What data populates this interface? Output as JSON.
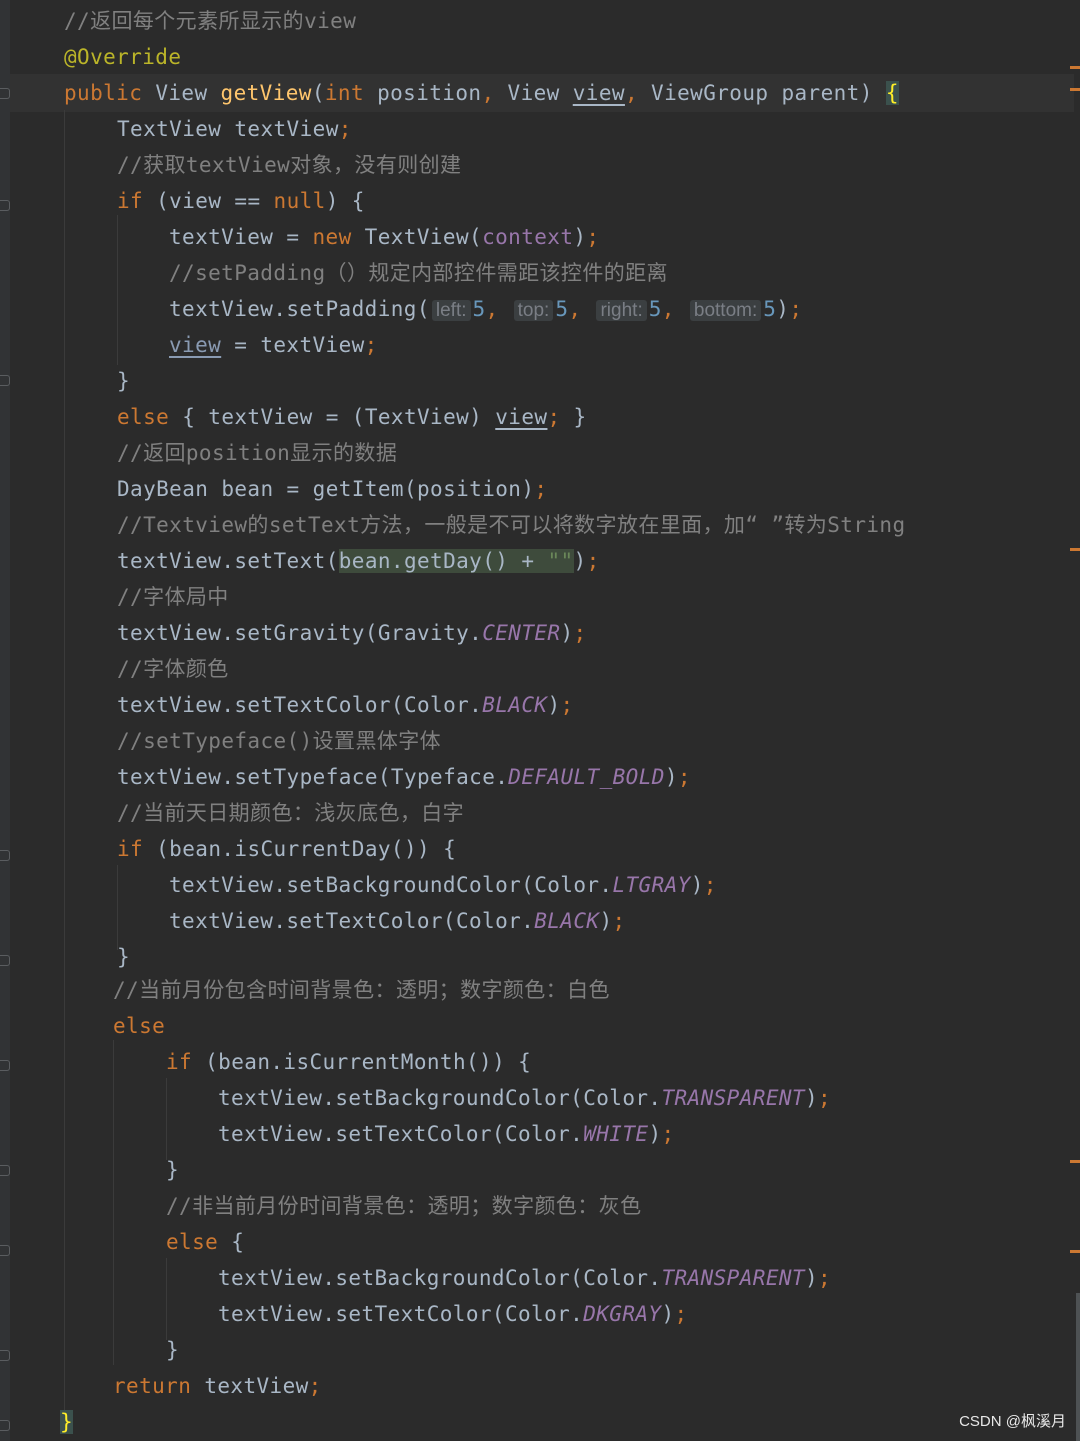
{
  "editor": {
    "lines": [
      [
        {
          "t": "//返回每个元素所显示的view",
          "c": "comment"
        }
      ],
      [
        {
          "t": "@Override",
          "c": "annotation"
        }
      ],
      [
        {
          "t": "public ",
          "c": "keyword"
        },
        {
          "t": "View "
        },
        {
          "t": "getView",
          "c": "method"
        },
        {
          "t": "("
        },
        {
          "t": "int ",
          "c": "keyword"
        },
        {
          "t": "position"
        },
        {
          "t": ", ",
          "c": "punct"
        },
        {
          "t": "View "
        },
        {
          "t": "view",
          "c": "var-under"
        },
        {
          "t": ", ",
          "c": "punct"
        },
        {
          "t": "ViewGroup parent) "
        },
        {
          "t": "{",
          "c": "brace-match"
        }
      ],
      [
        {
          "t": "TextView textView"
        },
        {
          "t": ";",
          "c": "punct"
        }
      ],
      [
        {
          "t": "//获取textView对象，没有则创建",
          "c": "comment"
        }
      ],
      [
        {
          "t": "if ",
          "c": "keyword"
        },
        {
          "t": "(view == "
        },
        {
          "t": "null",
          "c": "keyword"
        },
        {
          "t": ") {"
        }
      ],
      [
        {
          "t": "textView = "
        },
        {
          "t": "new ",
          "c": "keyword"
        },
        {
          "t": "TextView("
        },
        {
          "t": "context",
          "c": "field"
        },
        {
          "t": ")"
        },
        {
          "t": ";",
          "c": "punct"
        }
      ],
      [
        {
          "t": "//setPadding（）规定内部控件需距该控件的距离",
          "c": "comment"
        }
      ],
      [
        {
          "t": "textView.setPadding("
        },
        {
          "t": "left:",
          "c": "hint"
        },
        {
          "t": "5",
          "c": "number"
        },
        {
          "t": ", ",
          "c": "punct"
        },
        {
          "t": "top:",
          "c": "hint"
        },
        {
          "t": "5",
          "c": "number"
        },
        {
          "t": ", ",
          "c": "punct"
        },
        {
          "t": "right:",
          "c": "hint"
        },
        {
          "t": "5",
          "c": "number"
        },
        {
          "t": ", ",
          "c": "punct"
        },
        {
          "t": "bottom:",
          "c": "hint"
        },
        {
          "t": "5",
          "c": "number"
        },
        {
          "t": ")"
        },
        {
          "t": ";",
          "c": "punct"
        }
      ],
      [
        {
          "t": "view",
          "c": "var-dim"
        },
        {
          "t": " = textView"
        },
        {
          "t": ";",
          "c": "punct"
        }
      ],
      [
        {
          "t": "}"
        }
      ],
      [
        {
          "t": "else ",
          "c": "keyword"
        },
        {
          "t": "{ textView = (TextView) "
        },
        {
          "t": "view",
          "c": "var-under"
        },
        {
          "t": "; ",
          "c": "punct"
        },
        {
          "t": "}"
        }
      ],
      [
        {
          "t": "//返回position显示的数据",
          "c": "comment"
        }
      ],
      [
        {
          "t": "DayBean bean = getItem(position)"
        },
        {
          "t": ";",
          "c": "punct"
        }
      ],
      [
        {
          "t": "//Textview的setText方法，一般是不可以将数字放在里面，加“ ”转为String",
          "c": "comment"
        }
      ],
      [
        {
          "t": "textView.setText("
        },
        {
          "t": "bean.getDay() + ",
          "c": "sel-bg"
        },
        {
          "t": "\"\"",
          "c": "string-sel"
        },
        {
          "t": ")"
        },
        {
          "t": ";",
          "c": "punct"
        }
      ],
      [
        {
          "t": "//字体局中",
          "c": "comment"
        }
      ],
      [
        {
          "t": "textView.setGravity(Gravity."
        },
        {
          "t": "CENTER",
          "c": "const"
        },
        {
          "t": ")"
        },
        {
          "t": ";",
          "c": "punct"
        }
      ],
      [
        {
          "t": "//字体颜色",
          "c": "comment"
        }
      ],
      [
        {
          "t": "textView.setTextColor(Color."
        },
        {
          "t": "BLACK",
          "c": "const"
        },
        {
          "t": ")"
        },
        {
          "t": ";",
          "c": "punct"
        }
      ],
      [
        {
          "t": "//setTypeface()设置黑体字体",
          "c": "comment"
        }
      ],
      [
        {
          "t": "textView.setTypeface(Typeface."
        },
        {
          "t": "DEFAULT_BOLD",
          "c": "const"
        },
        {
          "t": ")"
        },
        {
          "t": ";",
          "c": "punct"
        }
      ],
      [
        {
          "t": "//当前天日期颜色：浅灰底色，白字",
          "c": "comment"
        }
      ],
      [
        {
          "t": "if ",
          "c": "keyword"
        },
        {
          "t": "(bean.isCurrentDay()) {"
        }
      ],
      [
        {
          "t": "textView.setBackgroundColor(Color."
        },
        {
          "t": "LTGRAY",
          "c": "const"
        },
        {
          "t": ")"
        },
        {
          "t": ";",
          "c": "punct"
        }
      ],
      [
        {
          "t": "textView.setTextColor(Color."
        },
        {
          "t": "BLACK",
          "c": "const"
        },
        {
          "t": ")"
        },
        {
          "t": ";",
          "c": "punct"
        }
      ],
      [
        {
          "t": "}"
        }
      ],
      [
        {
          "t": "//当前月份包含时间背景色：透明；数字颜色：白色",
          "c": "comment"
        }
      ],
      [
        {
          "t": "else",
          "c": "keyword"
        }
      ],
      [
        {
          "t": "if ",
          "c": "keyword"
        },
        {
          "t": "(bean.isCurrentMonth()) {"
        }
      ],
      [
        {
          "t": "textView.setBackgroundColor(Color."
        },
        {
          "t": "TRANSPARENT",
          "c": "const"
        },
        {
          "t": ")"
        },
        {
          "t": ";",
          "c": "punct"
        }
      ],
      [
        {
          "t": "textView.setTextColor(Color."
        },
        {
          "t": "WHITE",
          "c": "const"
        },
        {
          "t": ")"
        },
        {
          "t": ";",
          "c": "punct"
        }
      ],
      [
        {
          "t": "}"
        }
      ],
      [
        {
          "t": "//非当前月份时间背景色：透明；数字颜色：灰色",
          "c": "comment"
        }
      ],
      [
        {
          "t": "else ",
          "c": "keyword"
        },
        {
          "t": "{"
        }
      ],
      [
        {
          "t": "textView.setBackgroundColor(Color."
        },
        {
          "t": "TRANSPARENT",
          "c": "const"
        },
        {
          "t": ")"
        },
        {
          "t": ";",
          "c": "punct"
        }
      ],
      [
        {
          "t": "textView.setTextColor(Color."
        },
        {
          "t": "DKGRAY",
          "c": "const"
        },
        {
          "t": ")"
        },
        {
          "t": ";",
          "c": "punct"
        }
      ],
      [
        {
          "t": "}"
        }
      ],
      [
        {
          "t": "return ",
          "c": "keyword"
        },
        {
          "t": "textView"
        },
        {
          "t": ";",
          "c": "punct"
        }
      ],
      [
        {
          "t": "}",
          "c": "brace-match"
        }
      ]
    ]
  },
  "watermark": {
    "text": "CSDN @枫溪月"
  },
  "theme": {
    "background": "#2b2b2b",
    "keyword": "#cc7832",
    "comment": "#808080",
    "annotation": "#bbb529",
    "method": "#ffc66d",
    "constant": "#9876aa",
    "number": "#6897bb",
    "default_text": "#a9b7c6"
  }
}
